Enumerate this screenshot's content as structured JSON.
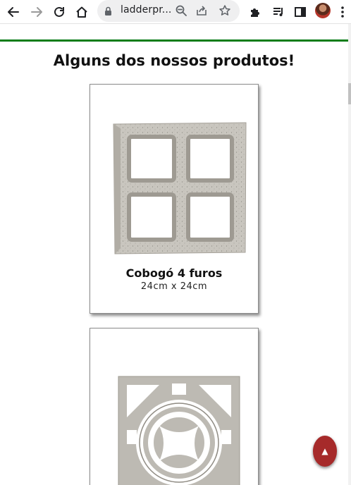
{
  "browser": {
    "url": "ladderpr...",
    "icons": {
      "back": "back-arrow-icon",
      "forward": "forward-arrow-icon",
      "reload": "reload-icon",
      "home": "home-icon",
      "lock": "lock-icon",
      "zoom": "zoom-icon",
      "share": "share-icon",
      "bookmark": "star-icon",
      "extensions": "puzzle-icon",
      "media": "media-queue-icon",
      "side_panel": "side-panel-icon",
      "menu": "kebab-menu-icon"
    }
  },
  "page": {
    "section_title": "Alguns dos nossos produtos!",
    "accent_color": "#0a7d19",
    "products": [
      {
        "name": "Cobogó 4 furos",
        "size": "24cm x 24cm"
      },
      {
        "name": "",
        "size": ""
      }
    ],
    "scroll_top_button": {
      "label": "▲",
      "color": "#a62a2a"
    }
  }
}
